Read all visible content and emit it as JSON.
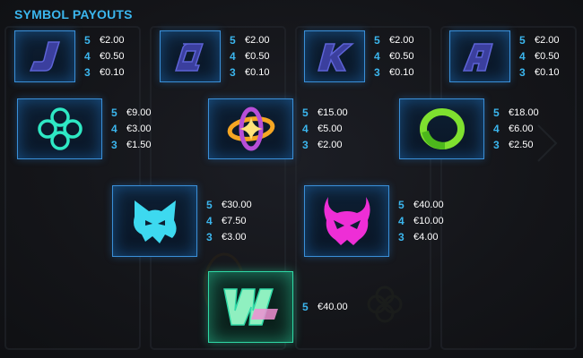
{
  "title": "SYMBOL PAYOUTS",
  "colors": {
    "accent": "#3bb6ee",
    "tile_border": "#3a8fd8",
    "wild_border": "#2fd9a6"
  },
  "symbols": [
    {
      "name": "J",
      "icon": "letter-j-icon",
      "pays": [
        {
          "count": "5",
          "amount": "€2.00"
        },
        {
          "count": "4",
          "amount": "€0.50"
        },
        {
          "count": "3",
          "amount": "€0.10"
        }
      ]
    },
    {
      "name": "Q",
      "icon": "letter-q-icon",
      "pays": [
        {
          "count": "5",
          "amount": "€2.00"
        },
        {
          "count": "4",
          "amount": "€0.50"
        },
        {
          "count": "3",
          "amount": "€0.10"
        }
      ]
    },
    {
      "name": "K",
      "icon": "letter-k-icon",
      "pays": [
        {
          "count": "5",
          "amount": "€2.00"
        },
        {
          "count": "4",
          "amount": "€0.50"
        },
        {
          "count": "3",
          "amount": "€0.10"
        }
      ]
    },
    {
      "name": "A",
      "icon": "letter-a-icon",
      "pays": [
        {
          "count": "5",
          "amount": "€2.00"
        },
        {
          "count": "4",
          "amount": "€0.50"
        },
        {
          "count": "3",
          "amount": "€0.10"
        }
      ]
    },
    {
      "name": "rings",
      "icon": "four-rings-icon",
      "pays": [
        {
          "count": "5",
          "amount": "€9.00"
        },
        {
          "count": "4",
          "amount": "€3.00"
        },
        {
          "count": "3",
          "amount": "€1.50"
        }
      ]
    },
    {
      "name": "star",
      "icon": "orbit-star-icon",
      "pays": [
        {
          "count": "5",
          "amount": "€15.00"
        },
        {
          "count": "4",
          "amount": "€5.00"
        },
        {
          "count": "3",
          "amount": "€2.00"
        }
      ]
    },
    {
      "name": "ring",
      "icon": "green-ring-icon",
      "pays": [
        {
          "count": "5",
          "amount": "€18.00"
        },
        {
          "count": "4",
          "amount": "€6.00"
        },
        {
          "count": "3",
          "amount": "€2.50"
        }
      ]
    },
    {
      "name": "cat",
      "icon": "cat-head-icon",
      "pays": [
        {
          "count": "5",
          "amount": "€30.00"
        },
        {
          "count": "4",
          "amount": "€7.50"
        },
        {
          "count": "3",
          "amount": "€3.00"
        }
      ]
    },
    {
      "name": "devil",
      "icon": "devil-head-icon",
      "pays": [
        {
          "count": "5",
          "amount": "€40.00"
        },
        {
          "count": "4",
          "amount": "€10.00"
        },
        {
          "count": "3",
          "amount": "€4.00"
        }
      ]
    },
    {
      "name": "wild",
      "icon": "wild-w-icon",
      "pays": [
        {
          "count": "5",
          "amount": "€40.00"
        }
      ]
    }
  ]
}
